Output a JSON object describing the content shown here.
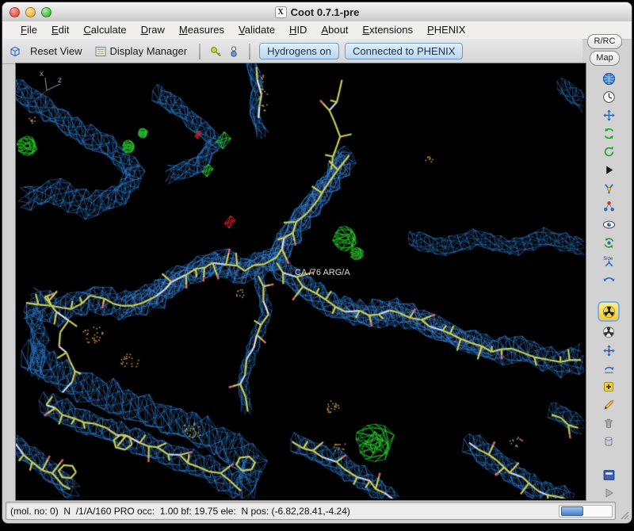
{
  "window": {
    "title": "Coot 0.7.1-pre",
    "x11_icon": "X"
  },
  "menu_bar": {
    "items": [
      "File",
      "Edit",
      "Calculate",
      "Draw",
      "Measures",
      "Validate",
      "HID",
      "About",
      "Extensions",
      "PHENIX"
    ]
  },
  "toolbar": {
    "reset_view_label": "Reset View",
    "display_manager_label": "Display Manager",
    "hydrogens_toggle_label": "Hydrogens on",
    "phenix_toggle_label": "Connected to PHENIX"
  },
  "map_controls": {
    "r_rc_label": "R/RC",
    "map_label": "Map"
  },
  "right_toolbar": {
    "icons": [
      "globe-icon",
      "clock-icon",
      "translate-icon",
      "rotate-icon",
      "spin-icon",
      "play-icon",
      "flask-icon",
      "atoms-icon",
      "eye-icon",
      "cycle-icon",
      "side-chain-icon",
      "flip-icon",
      "refine-radiation-icon",
      "regularize-radiation-icon",
      "drag-icon",
      "pepflip-icon",
      "add-residue-icon",
      "pencil-icon",
      "trash-icon",
      "cylinder-icon",
      "flag-icon",
      "play-disabled-icon"
    ]
  },
  "viewport": {
    "atom_label": "CA /76 ARG/A",
    "axis_x_label": "x",
    "axis_z_label": "z",
    "background": "#000000",
    "map_mesh_color": "#2e7fd4",
    "map_mesh_light_color": "#4f95e8",
    "positive_diff_color": "#25c82a",
    "negative_diff_color": "#cc2424",
    "model_carbon_color": "#cdcd55",
    "model_nitrogen_color": "#c9d3e8",
    "oxygen_tick_color": "#e0688a",
    "water_dot_color": "#c49a35"
  },
  "status_bar": {
    "text": "(mol. no: 0)  N  /1/A/160 PRO occ:  1.00 bf: 19.75 ele:  N pos: (-6.82,28.41,-4.24)"
  }
}
